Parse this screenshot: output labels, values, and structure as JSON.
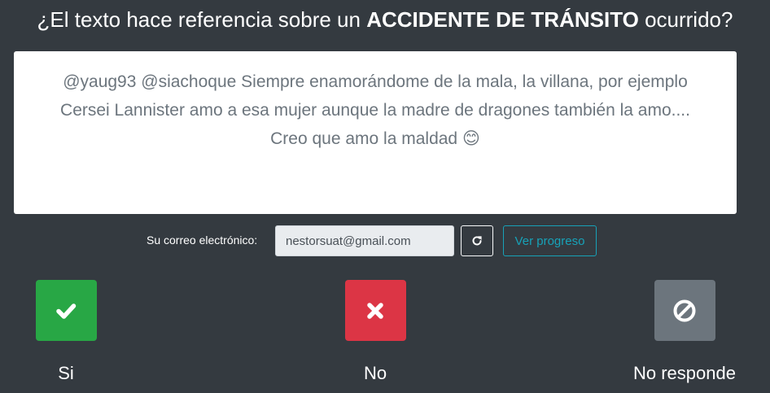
{
  "question": {
    "prefix": "¿El texto hace referencia sobre un ",
    "emphasis": "ACCIDENTE DE TRÁNSITO",
    "suffix": " ocurrido?"
  },
  "tweet_text": "@yaug93 @siachoque Siempre enamorándome de la mala, la villana, por ejemplo Cersei Lannister amo a esa mujer aunque la madre de dragones también la amo.... Creo que amo la maldad 😊",
  "email": {
    "label": "Su correo electrónico:",
    "value": "nestorsuat@gmail.com",
    "refresh_icon": "refresh-icon",
    "progress_label": "Ver progreso"
  },
  "answers": [
    {
      "label": "Si",
      "icon": "check-icon",
      "color": "#28a745"
    },
    {
      "label": "No",
      "icon": "times-icon",
      "color": "#dc3545"
    },
    {
      "label": "No responde",
      "icon": "ban-icon",
      "color": "#6c757d"
    }
  ],
  "colors": {
    "background": "#343a40",
    "tweet_text": "#6c757d",
    "progress_outline": "#17a2b8"
  }
}
